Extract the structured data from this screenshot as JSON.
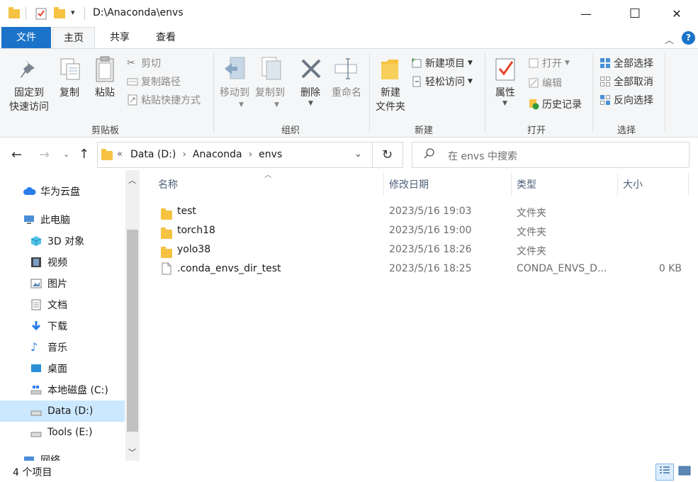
{
  "window": {
    "title": "D:\\Anaconda\\envs",
    "minimize_glyph": "—",
    "maximize_glyph": "☐",
    "close_glyph": "✕"
  },
  "tabs": [
    {
      "label": "文件"
    },
    {
      "label": "主页"
    },
    {
      "label": "共享"
    },
    {
      "label": "查看"
    }
  ],
  "ribbon": {
    "clipboard": {
      "label": "剪贴板",
      "pin_line1": "固定到",
      "pin_line2": "快速访问",
      "copy": "复制",
      "paste": "粘贴",
      "cut": "剪切",
      "copy_path": "复制路径",
      "paste_shortcut": "粘贴快捷方式"
    },
    "organize": {
      "label": "组织",
      "move_to": "移动到",
      "copy_to": "复制到",
      "delete": "删除",
      "rename": "重命名"
    },
    "new": {
      "label": "新建",
      "new_folder_line1": "新建",
      "new_folder_line2": "文件夹",
      "new_item": "新建项目",
      "easy_access": "轻松访问"
    },
    "open": {
      "label": "打开",
      "properties": "属性",
      "open": "打开",
      "edit": "编辑",
      "history": "历史记录"
    },
    "select": {
      "label": "选择",
      "select_all": "全部选择",
      "select_none": "全部取消",
      "invert": "反向选择"
    }
  },
  "address": {
    "overflow": "«",
    "crumbs": [
      "Data (D:)",
      "Anaconda",
      "envs"
    ],
    "search_placeholder": "在 envs 中搜索"
  },
  "nav": [
    {
      "label": "华为云盘",
      "icon": "cloud-icon"
    },
    {
      "label": "此电脑",
      "icon": "pc-icon"
    },
    {
      "label": "3D 对象",
      "icon": "3d-icon"
    },
    {
      "label": "视频",
      "icon": "video-icon"
    },
    {
      "label": "图片",
      "icon": "picture-icon"
    },
    {
      "label": "文档",
      "icon": "document-icon"
    },
    {
      "label": "下载",
      "icon": "download-icon"
    },
    {
      "label": "音乐",
      "icon": "music-icon"
    },
    {
      "label": "桌面",
      "icon": "desktop-icon"
    },
    {
      "label": "本地磁盘 (C:)",
      "icon": "drive-c-icon"
    },
    {
      "label": "Data (D:)",
      "icon": "drive-icon",
      "selected": true
    },
    {
      "label": "Tools (E:)",
      "icon": "drive-icon"
    },
    {
      "label": "网络",
      "icon": "network-icon"
    }
  ],
  "columns": {
    "name": "名称",
    "modified": "修改日期",
    "type": "类型",
    "size": "大小"
  },
  "files": [
    {
      "name": "test",
      "modified": "2023/5/16 19:03",
      "type": "文件夹",
      "size": "",
      "kind": "folder"
    },
    {
      "name": "torch18",
      "modified": "2023/5/16 19:00",
      "type": "文件夹",
      "size": "",
      "kind": "folder"
    },
    {
      "name": "yolo38",
      "modified": "2023/5/16 18:26",
      "type": "文件夹",
      "size": "",
      "kind": "folder"
    },
    {
      "name": ".conda_envs_dir_test",
      "modified": "2023/5/16 18:25",
      "type": "CONDA_ENVS_D...",
      "size": "0 KB",
      "kind": "file"
    }
  ],
  "status": {
    "count": "4 个项目"
  }
}
